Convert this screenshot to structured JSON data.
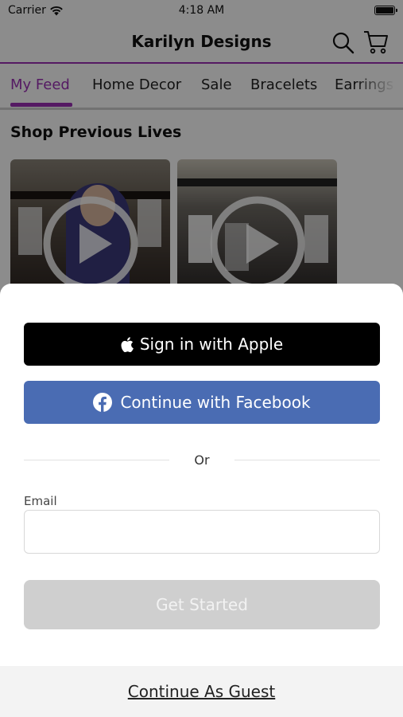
{
  "status_bar": {
    "carrier": "Carrier",
    "time": "4:18 AM"
  },
  "header": {
    "title": "Karilyn Designs",
    "accent_color": "#9b30b5"
  },
  "tabs": [
    {
      "label": "My Feed",
      "active": true
    },
    {
      "label": "Home Decor",
      "active": false
    },
    {
      "label": "Sale",
      "active": false
    },
    {
      "label": "Bracelets",
      "active": false
    },
    {
      "label": "Earrings",
      "active": false
    }
  ],
  "feed": {
    "section_title": "Shop Previous Lives"
  },
  "auth_sheet": {
    "apple_button": "Sign in with Apple",
    "facebook_button": "Continue with Facebook",
    "or_text": "Or",
    "email_label": "Email",
    "email_value": "",
    "get_started_button": "Get Started",
    "guest_link": "Continue As Guest",
    "facebook_color": "#4a6cb3"
  }
}
